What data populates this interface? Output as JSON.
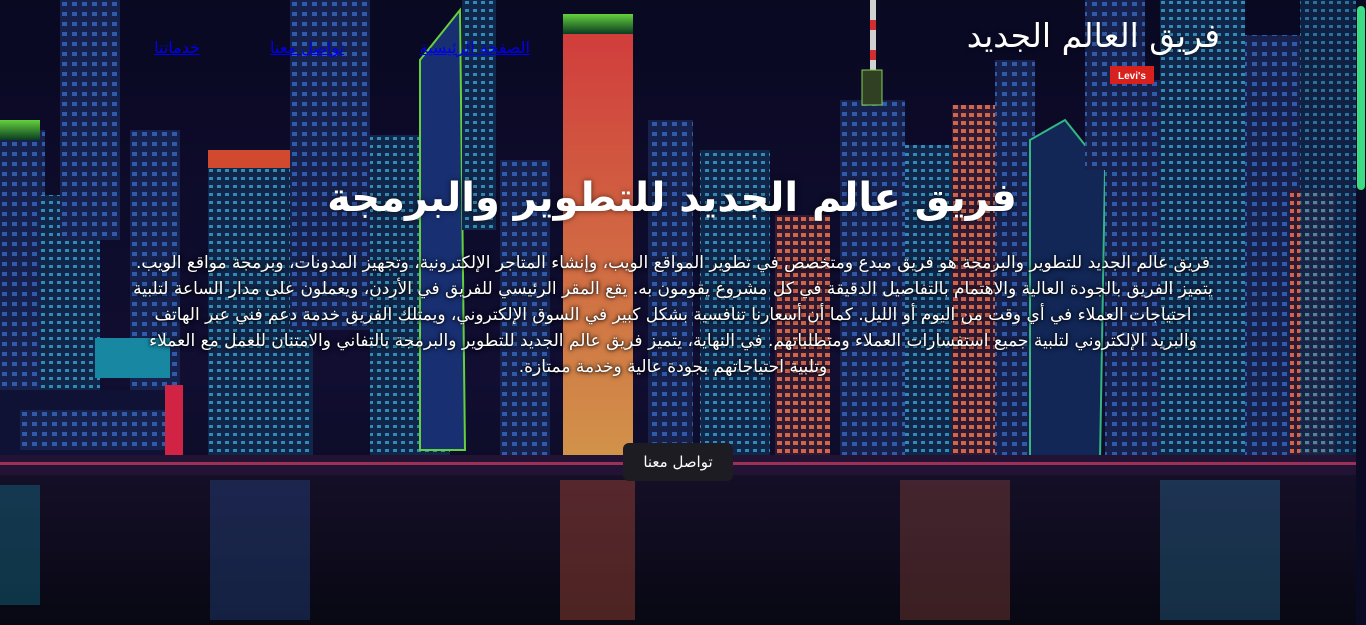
{
  "header": {
    "brand": "فريق العالم الجديد",
    "nav": [
      {
        "label": "الصفحة الرئيسية"
      },
      {
        "label": "تواصل معنا"
      },
      {
        "label": "خدماتنا"
      }
    ]
  },
  "hero": {
    "title": "فريق عالم الجديد للتطوير والبرمجة",
    "description": "فريق عالم الجديد للتطوير والبرمجة هو فريق مبدع ومتخصص في تطوير المواقع الويب، وإنشاء المتاجر الإلكترونية، وتجهيز المدونات، وبرمجة مواقع الويب. يتميز الفريق بالجودة العالية والاهتمام بالتفاصيل الدقيقة في كل مشروع يقومون به. يقع المقر الرئيسي للفريق في الأردن، ويعملون على مدار الساعة لتلبية احتياجات العملاء في أي وقت من اليوم أو الليل. كما أن أسعارنا تنافسية بشكل كبير في السوق الإلكتروني، ويمتلك الفريق خدمة دعم فني عبر الهاتف والبريد الإلكتروني لتلبية جميع استفسارات العملاء ومتطلباتهم. في النهاية، يتميز فريق عالم الجديد للتطوير والبرمجة بالتفاني والامتنان للعمل مع العملاء وتلبية احتياجاتهم بجودة عالية وخدمة ممتازة.",
    "cta_label": "تواصل معنا"
  },
  "background": {
    "sign_label": "Levi's"
  },
  "colors": {
    "accent": "#3ddc84",
    "sky": "#0b0a24",
    "button": "#1d1c22"
  }
}
